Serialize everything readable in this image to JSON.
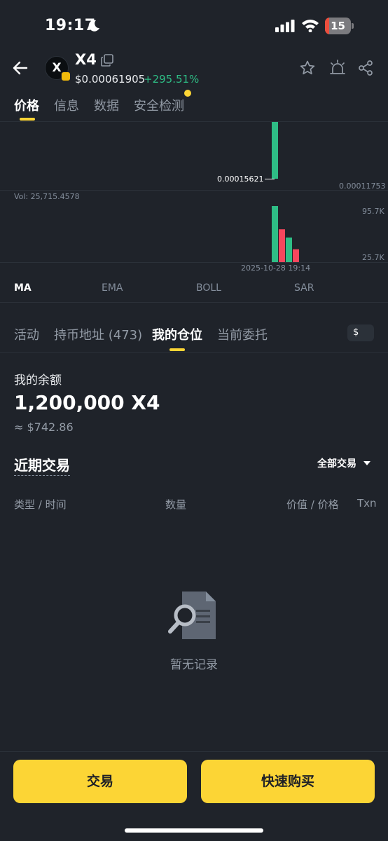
{
  "status_bar": {
    "time": "19:17",
    "battery": "15",
    "battery_level": 0.15
  },
  "token": {
    "avatar_letter": "X",
    "symbol": "X4",
    "price": "$0.00061905",
    "change": "+295.51%"
  },
  "tabs": [
    {
      "label": "价格",
      "active": true
    },
    {
      "label": "信息",
      "active": false
    },
    {
      "label": "数据",
      "active": false
    },
    {
      "label": "安全检测",
      "active": false
    }
  ],
  "chart": {
    "price_tag": "0.00015621",
    "price_right": "0.00011753",
    "vol_label": "Vol: 25,715.4578",
    "vol_high": "95.7K",
    "vol_low": "25.7K",
    "timestamp": "2025-10-28 19:14",
    "up_color": "#2ebd85",
    "down_color": "#f6465d"
  },
  "chart_data": {
    "type": "bar",
    "title": "",
    "series": [
      {
        "values": [
          95.7,
          56,
          42,
          22
        ]
      }
    ],
    "volume_axis_labels": [
      "95.7K",
      "25.7K"
    ],
    "price_labels": [
      "0.00015621",
      "0.00011753"
    ],
    "time_label": "2025-10-28 19:14",
    "bar_colors": [
      "up",
      "down",
      "up",
      "down"
    ]
  },
  "indicators": [
    "MA",
    "EMA",
    "BOLL",
    "SAR"
  ],
  "sub_tabs": [
    {
      "label": "活动",
      "active": false
    },
    {
      "label": "持币地址 (473)",
      "active": false
    },
    {
      "label": "我的仓位",
      "active": true
    },
    {
      "label": "当前委托",
      "active": false
    }
  ],
  "currency_toggle": "$",
  "balance": {
    "label": "我的余额",
    "amount": "1,200,000 X4",
    "usd": "≈ $742.86"
  },
  "recent": {
    "title": "近期交易",
    "filter": "全部交易",
    "columns": [
      "类型 / 时间",
      "数量",
      "价值 / 价格",
      "Txn"
    ],
    "empty_text": "暂无记录"
  },
  "buttons": {
    "trade": "交易",
    "quick_buy": "快速购买"
  }
}
